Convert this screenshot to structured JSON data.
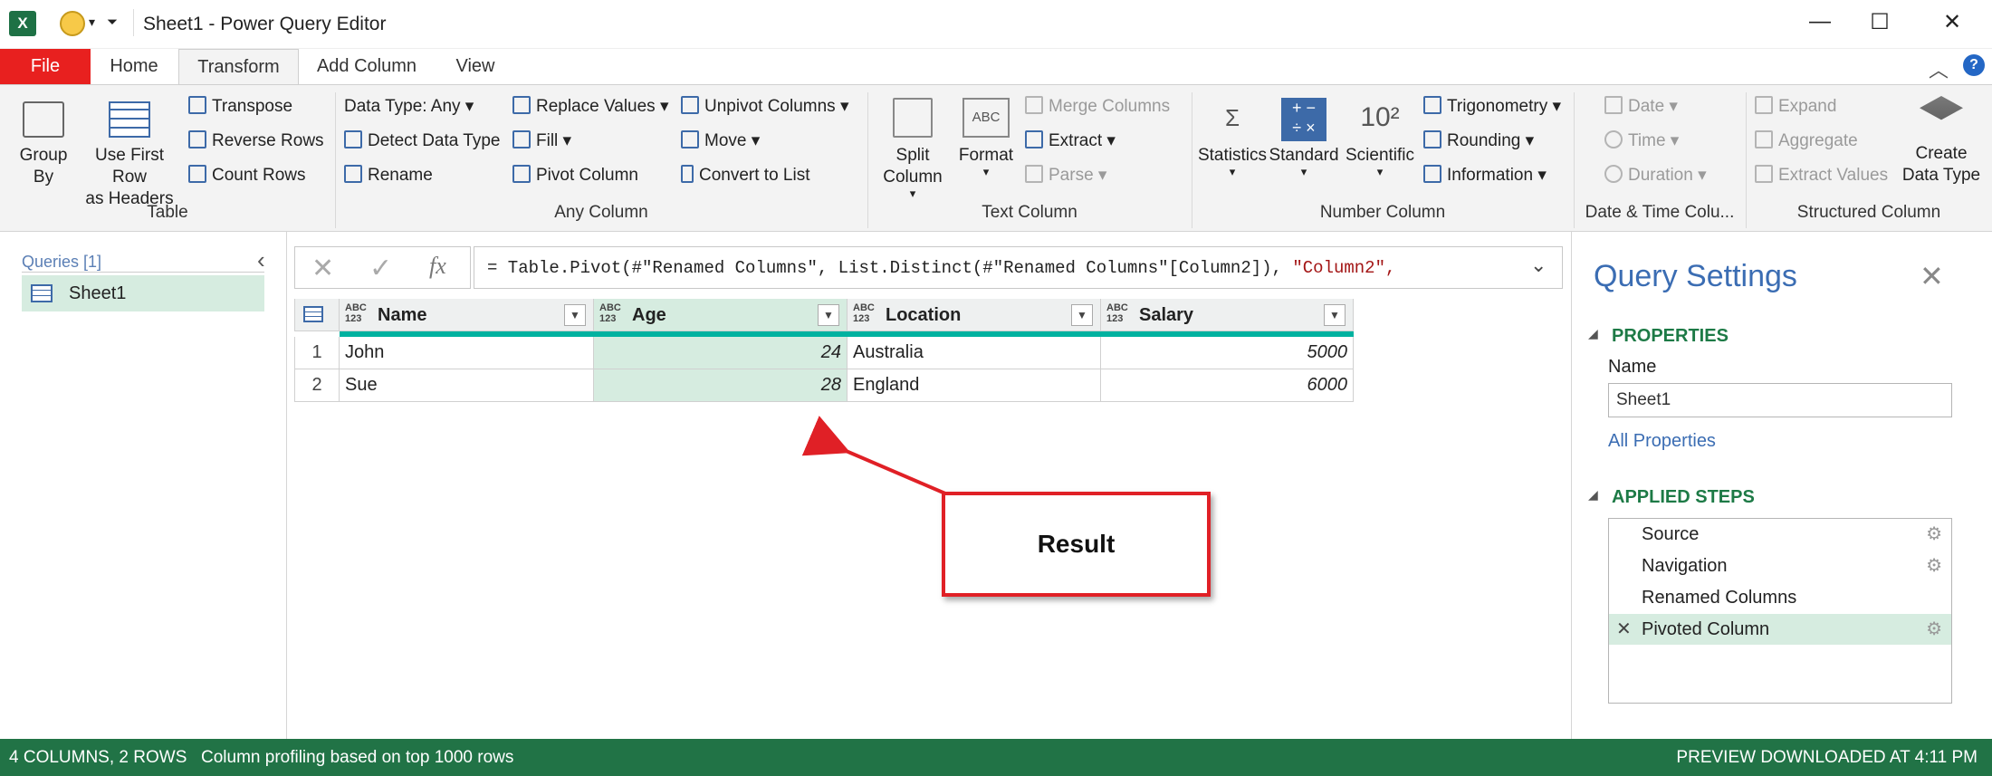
{
  "window": {
    "title": "Sheet1 - Power Query Editor",
    "minimize": "—",
    "maximize": "☐",
    "close": "✕"
  },
  "tabs": [
    {
      "label": "File"
    },
    {
      "label": "Home"
    },
    {
      "label": "Transform"
    },
    {
      "label": "Add Column"
    },
    {
      "label": "View"
    }
  ],
  "help": "?",
  "ribbon": {
    "table": {
      "group_label": "Table",
      "group_by": "Group\nBy",
      "use_first_row": "Use First Row\nas Headers",
      "transpose": "Transpose",
      "reverse_rows": "Reverse Rows",
      "count_rows": "Count Rows"
    },
    "any_column": {
      "group_label": "Any Column",
      "data_type": "Data Type: Any",
      "detect_data_type": "Detect Data Type",
      "rename": "Rename",
      "replace_values": "Replace Values",
      "fill": "Fill",
      "pivot_column": "Pivot Column",
      "unpivot_columns": "Unpivot Columns",
      "move": "Move",
      "convert_to_list": "Convert to List"
    },
    "text_column": {
      "group_label": "Text Column",
      "split_column": "Split\nColumn",
      "format": "Format",
      "merge_columns": "Merge Columns",
      "extract": "Extract",
      "parse": "Parse"
    },
    "number_column": {
      "group_label": "Number Column",
      "statistics": "Statistics",
      "standard": "Standard",
      "scientific": "Scientific",
      "trigonometry": "Trigonometry",
      "rounding": "Rounding",
      "information": "Information"
    },
    "date_time": {
      "group_label": "Date & Time Colu...",
      "date": "Date",
      "time": "Time",
      "duration": "Duration"
    },
    "structured": {
      "group_label": "Structured Column",
      "expand": "Expand",
      "aggregate": "Aggregate",
      "extract_values": "Extract Values",
      "create_data_type": "Create\nData Type"
    }
  },
  "queries": {
    "label": "Queries [1]",
    "items": [
      {
        "name": "Sheet1"
      }
    ]
  },
  "formula": {
    "prefix": "= Table.Pivot(#\"Renamed Columns\", List.Distinct(#\"Renamed Columns\"[Column2]), ",
    "string_part": "\"Column2\","
  },
  "grid": {
    "type_badge": "ABC\n123",
    "columns": [
      {
        "name": "Name"
      },
      {
        "name": "Age"
      },
      {
        "name": "Location"
      },
      {
        "name": "Salary"
      }
    ],
    "rows": [
      {
        "num": "1",
        "cells": [
          "John",
          "24",
          "Australia",
          "5000"
        ]
      },
      {
        "num": "2",
        "cells": [
          "Sue",
          "28",
          "England",
          "6000"
        ]
      }
    ]
  },
  "annotation": {
    "label": "Result"
  },
  "query_settings": {
    "title": "Query Settings",
    "properties_header": "PROPERTIES",
    "name_label": "Name",
    "name_value": "Sheet1",
    "all_properties": "All Properties",
    "applied_steps_header": "APPLIED STEPS",
    "steps": [
      {
        "label": "Source",
        "gear": true
      },
      {
        "label": "Navigation",
        "gear": true
      },
      {
        "label": "Renamed Columns",
        "gear": false
      },
      {
        "label": "Pivoted Column",
        "gear": true
      }
    ]
  },
  "status": {
    "left": "4 COLUMNS, 2 ROWS",
    "middle": "Column profiling based on top 1000 rows",
    "right": "PREVIEW DOWNLOADED AT 4:11 PM"
  },
  "colors": {
    "file_tab": "#e8201f",
    "status_bar": "#217346",
    "selection": "#d6ece0",
    "quality_bar": "#00b2a0",
    "accent_blue": "#3b6db3",
    "section_green": "#1d7a46",
    "callout_border": "#e02026"
  }
}
